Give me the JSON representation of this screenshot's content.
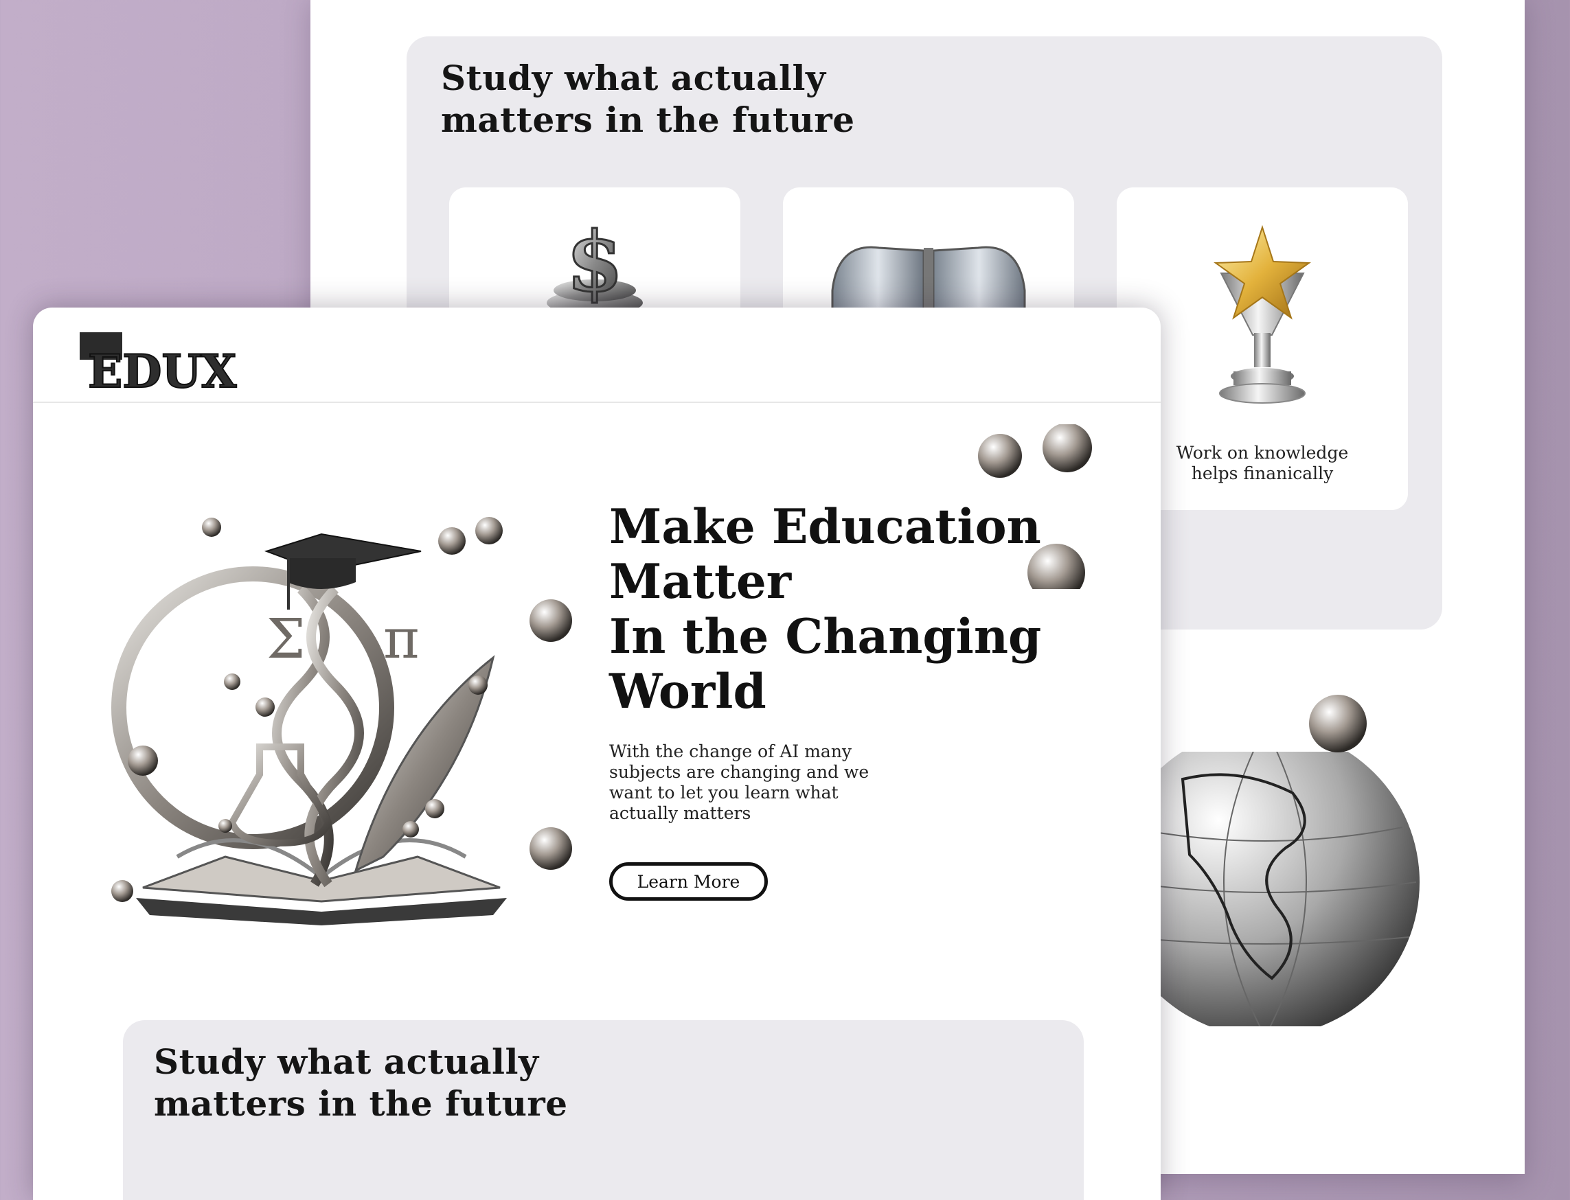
{
  "back_page": {
    "section_title": [
      "Study what actually",
      "matters in the future"
    ],
    "cards": [
      {
        "icon": "dollar-coin-icon",
        "caption": ""
      },
      {
        "icon": "open-book-icon",
        "caption": ""
      },
      {
        "icon": "trophy-star-icon",
        "caption": [
          "Work on knowledge",
          "helps finanically"
        ]
      }
    ]
  },
  "front_page": {
    "logo": "EDUX",
    "hero": {
      "title": [
        "Make Education",
        "Matter",
        "In the Changing",
        "World"
      ],
      "subtitle": [
        "With the change of AI many",
        "subjects are changing and we",
        "want to let you learn what",
        "actually matters"
      ],
      "button": "Learn More",
      "illustration_symbols": [
        "Σ",
        "π"
      ]
    },
    "section_title": [
      "Study what actually",
      "matters in the future"
    ]
  },
  "colors": {
    "background": "#bda9c5",
    "panel": "#ebeaee",
    "text": "#111111"
  }
}
